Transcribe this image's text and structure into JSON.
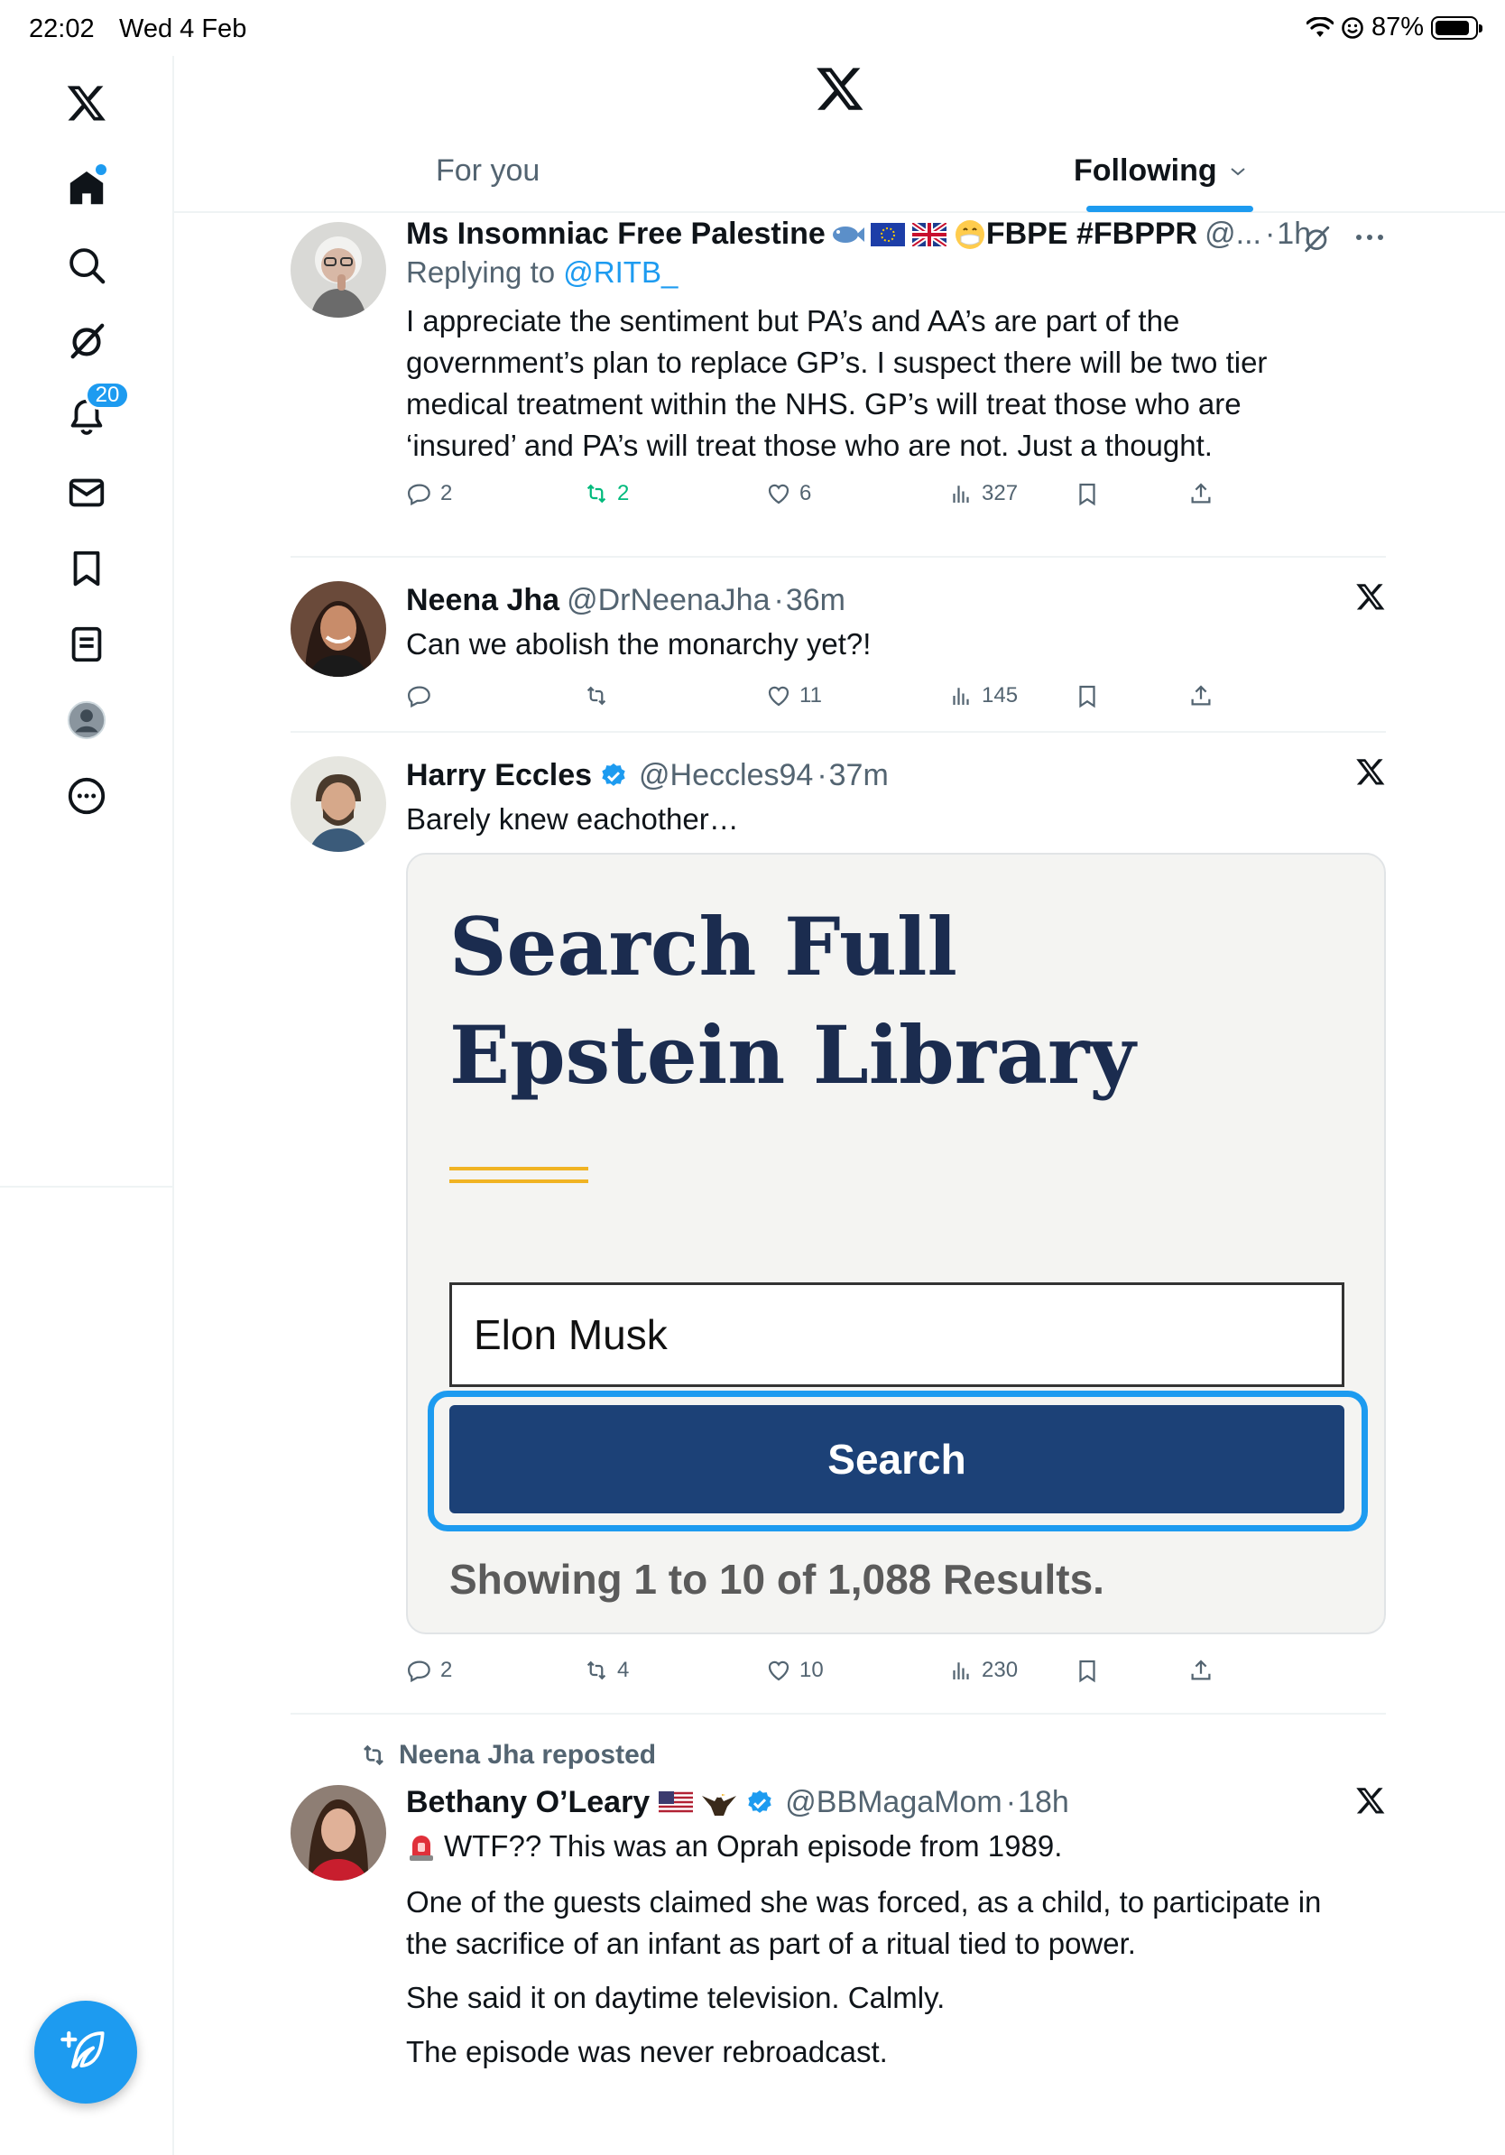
{
  "status_bar": {
    "time": "22:02",
    "date": "Wed 4 Feb",
    "battery": "87%",
    "battery_level": 0.87
  },
  "notifications": {
    "count": "20"
  },
  "header": {
    "tab_for_you": "For you",
    "tab_following": "Following"
  },
  "posts": [
    {
      "name": "Ms Insomniac Free Palestine",
      "name_suffix": "FBPE #FBPPR",
      "handle": "@...",
      "time": "1h",
      "reply_prefix": "Replying to",
      "reply_handle": "@RITB_",
      "text": "I appreciate the sentiment but PA’s and AA’s are part of the government’s plan to replace GP’s. I suspect there will be two tier medical treatment within the NHS. GP’s will treat those who are ‘insured’ and PA’s will treat those who are not. Just a thought.",
      "replies": "2",
      "reposts": "2",
      "likes": "6",
      "views": "327"
    },
    {
      "name": "Neena Jha",
      "handle": "@DrNeenaJha",
      "time": "36m",
      "text": "Can we abolish the monarchy yet?!",
      "replies": "",
      "reposts": "",
      "likes": "11",
      "views": "145"
    },
    {
      "name": "Harry Eccles",
      "handle": "@Heccles94",
      "time": "37m",
      "text": "Barely knew eachother…",
      "card": {
        "title": "Search Full Epstein Library",
        "input_value": "Elon Musk",
        "button_label": "Search",
        "results": "Showing 1 to 10 of 1,088 Results."
      },
      "replies": "2",
      "reposts": "4",
      "likes": "10",
      "views": "230"
    },
    {
      "repost_label": "Neena Jha reposted",
      "name": "Bethany O’Leary",
      "handle": "@BBMagaMom",
      "time": "18h",
      "text_1": "WTF?? This was an Oprah episode from 1989.",
      "text_2": "One of the guests claimed she was forced, as a child, to participate in the sacrifice of an infant as part of a ritual tied to power.",
      "text_3": "She said it on daytime television. Calmly.",
      "text_4": "The episode was never rebroadcast."
    }
  ],
  "icons": [
    "x-logo-icon",
    "home-icon",
    "search-icon",
    "grok-icon",
    "bell-icon",
    "mail-icon",
    "bookmark-icon",
    "lists-icon",
    "profile-icon",
    "more-icon",
    "compose-icon",
    "reply-icon",
    "repost-icon",
    "like-icon",
    "views-icon",
    "share-icon",
    "verified-icon",
    "chevron-down-icon"
  ],
  "colors": {
    "accent": "#1d9bf0",
    "repost_active": "#00ba7c",
    "card_title": "#1b2c4f",
    "card_button": "#1c4177",
    "card_rule": "#f0b323"
  }
}
